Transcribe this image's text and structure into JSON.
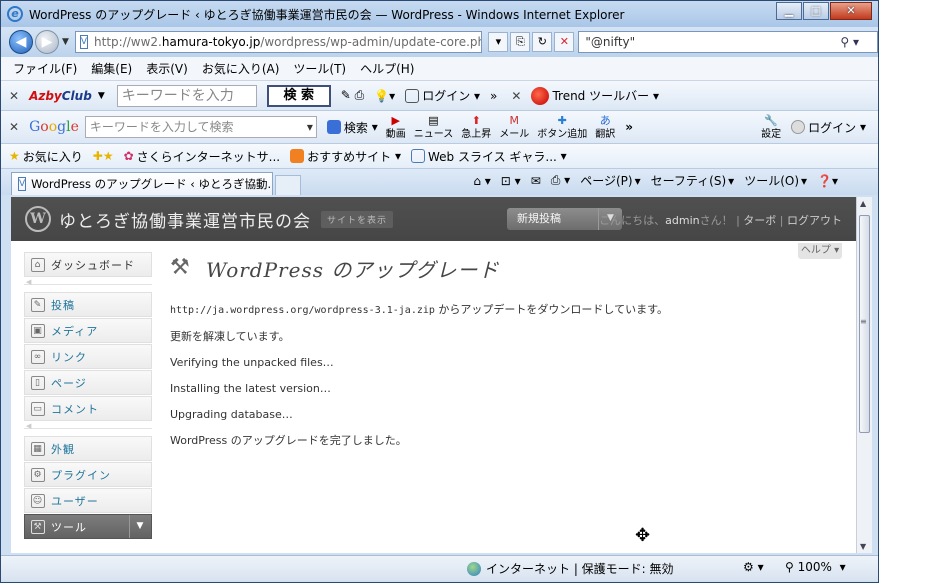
{
  "window": {
    "title": "WordPress のアップグレード ‹ ゆとろぎ協働事業運営市民の会 — WordPress - Windows Internet Explorer",
    "min_glyph": "▁",
    "max_glyph": "□",
    "close_glyph": "✕"
  },
  "address": {
    "url_prefix": "http://ww2.",
    "url_host": "hamura-tokyo.jp",
    "url_rest": "/wordpress/wp-admin/update-core.php?act",
    "search_value": "\"@nifty\""
  },
  "menu": [
    "ファイル(F)",
    "編集(E)",
    "表示(V)",
    "お気に入り(A)",
    "ツール(T)",
    "ヘルプ(H)"
  ],
  "azby_toolbar": {
    "brand_a": "Azby",
    "brand_b": "Club",
    "keyword_placeholder": "キーワードを入力",
    "search_label": "検 索",
    "login_label": "ログイン",
    "more": "»",
    "trend_label": "Trend ツールバー"
  },
  "google_toolbar": {
    "brand": [
      "G",
      "o",
      "o",
      "g",
      "l",
      "e"
    ],
    "keyword_placeholder": "キーワードを入力して検索",
    "search_label": "検索",
    "tools": [
      "動画",
      "ニュース",
      "急上昇",
      "メール",
      "ボタン追加",
      "翻訳"
    ],
    "more": "»",
    "settings_label": "設定",
    "login_label": "ログイン"
  },
  "favorites_bar": {
    "favorites_label": "お気に入り",
    "items": [
      "さくらインターネットサ...",
      "おすすめサイト",
      "Web スライス ギャラ..."
    ]
  },
  "tab": {
    "title": "WordPress のアップグレード ‹ ゆとろぎ協動..."
  },
  "command_bar": [
    "ページ(P)",
    "セーフティ(S)",
    "ツール(O)"
  ],
  "wp_header": {
    "logo_letter": "W",
    "site_name": "ゆとろぎ協働事業運営市民の会",
    "visit_site": "サイトを表示",
    "new_post": "新規投稿",
    "greeting_prefix": "こんにちは、",
    "user": "admin",
    "greeting_suffix": "さん！ | ",
    "turbo": "ターボ",
    "sep": " | ",
    "logout": "ログアウト",
    "help": "ヘルプ ▾"
  },
  "sidebar": {
    "dashboard": "ダッシュボード",
    "group1": [
      "投稿",
      "メディア",
      "リンク",
      "ページ",
      "コメント"
    ],
    "group2": [
      "外観",
      "プラグイン",
      "ユーザー"
    ],
    "current": "ツール"
  },
  "page": {
    "title": "WordPress のアップグレード",
    "download_url": "http://ja.wordpress.org/wordpress-3.1-ja.zip",
    "download_suffix": " からアップデートをダウンロードしています。",
    "messages": [
      "更新を解凍しています。",
      "Verifying the unpacked files…",
      "Installing the latest version…",
      "Upgrading database…",
      "WordPress のアップグレードを完了しました。"
    ]
  },
  "status": {
    "zone": "インターネット | 保護モード: 無効",
    "zoom": "100%"
  }
}
